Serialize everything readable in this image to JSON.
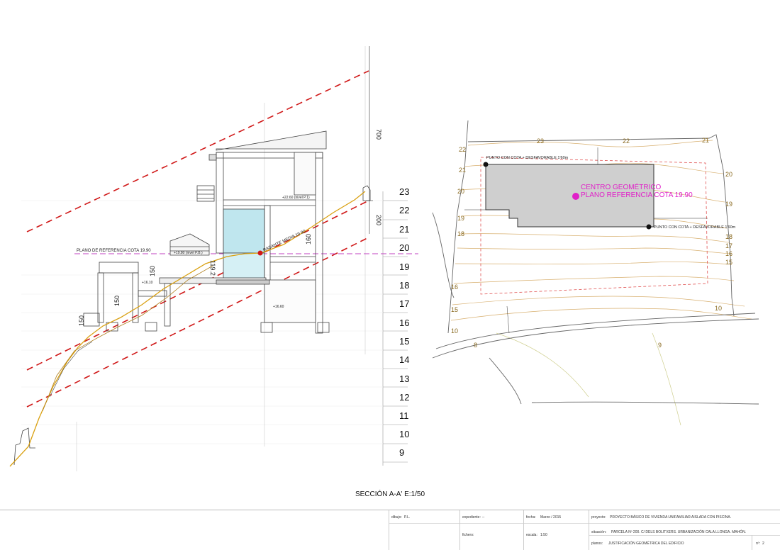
{
  "section": {
    "title": "SECCIÓN A-A'  E:1/50",
    "levels": [
      "23",
      "22",
      "21",
      "20",
      "19",
      "18",
      "17",
      "16",
      "15",
      "14",
      "13",
      "12",
      "11",
      "10",
      "9"
    ],
    "reference_plane": "PLANO DE REFERENCIA  COTA  19.90",
    "rasante": "RASANTE MEDIA 19.90",
    "dims": {
      "d700": "700",
      "d200": "200",
      "d160": "160",
      "d150a": "150",
      "d150b": "150",
      "d150c": "150",
      "d119": "119.2"
    },
    "notes": {
      "n1": "+22.60 (nivel P.1)",
      "n2": "+19.80 (nivel P.B.)",
      "n3": "+16.10",
      "n4": "+16.60"
    }
  },
  "plan": {
    "center_label_1": "CENTRO GEOMÉTRICO",
    "center_label_2": "PLANO REFERENCIA COTA 19.90",
    "point_label_1": "PUNTO CON COTA + DESFAVORABLE 1'60m",
    "point_label_2": "PUNTO CON COTA + DESFAVORABLE 1'60m",
    "contours": {
      "c23": "23",
      "c22": "22",
      "c21": "21",
      "c22l": "22",
      "c21l": "21",
      "c20l": "20",
      "c19l": "19",
      "c18l": "18",
      "c20r": "20",
      "c19r": "19",
      "c18r": "18",
      "c17r": "17",
      "c16r": "16",
      "c15r": "15",
      "c10r": "10",
      "c9": "9",
      "c8": "8",
      "c10l": "10",
      "c15l": "15",
      "c16l": "16"
    }
  },
  "colors": {
    "red": "#d01818",
    "magenta": "#e020c8",
    "contour": "#d8b070",
    "pool": "#bfe6ee",
    "building": "#cfcfcf",
    "terrain": "#d9a010"
  },
  "cartouche": {
    "dibujo_label": "dibujo:",
    "dibujo": "P.L.",
    "expediente_label": "expediente:",
    "expediente": "--",
    "fecha_label": "fecha:",
    "fecha": "Marzo / 2015",
    "proyecto_label": "proyecto:",
    "proyecto": "PROYECTO BÁSICO DE VIVIENDA UNIFAMILIAR AISLADA CON PISCINA.",
    "fichero_label": "fichero:",
    "escala_label": "escala:",
    "escala": "1:50",
    "situacion_label": "situación:",
    "situacion": "PARCELA Nº 200. C/ DELS BOLITXERS. URBANIZACIÓN CALA LLONGA. MAHÓN.",
    "planos_label": "planos:",
    "planos": "JUSTIFICACIÓN GEOMÉTRICA DEL EDIFICIO",
    "n_label": "nº:",
    "n": "2"
  }
}
